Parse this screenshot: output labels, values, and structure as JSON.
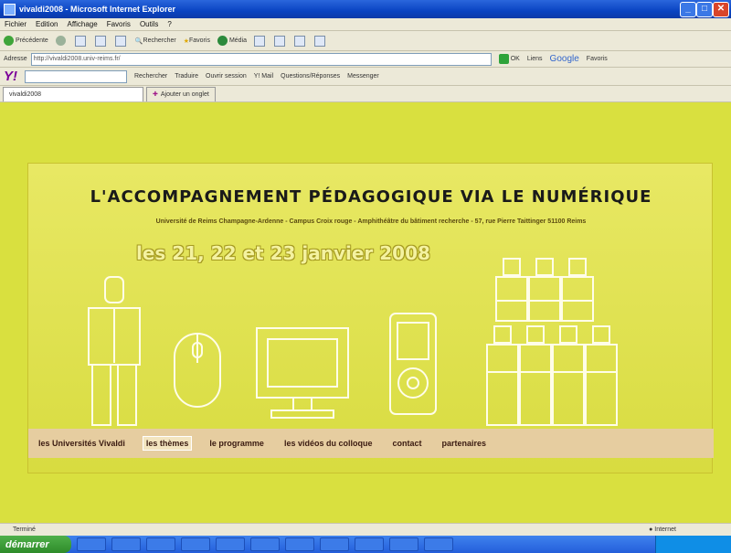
{
  "window": {
    "title": "vivaldi2008 - Microsoft Internet Explorer"
  },
  "menubar": [
    "Fichier",
    "Edition",
    "Affichage",
    "Favoris",
    "Outils",
    "?"
  ],
  "toolbar": {
    "back": "Précédente",
    "search": "Rechercher",
    "favorites": "Favoris",
    "media": "Média"
  },
  "addressbar": {
    "label": "Adresse",
    "url": "http://vivaldi2008.univ-reims.fr/",
    "go": "OK",
    "links": "Liens",
    "google": "Google",
    "favorites": "Favoris"
  },
  "yahoobar": {
    "logo": "Y!",
    "search_btn": "Rechercher",
    "translate": "Traduire",
    "open_session": "Ouvrir session",
    "mail": "Y! Mail",
    "qa": "Questions/Réponses",
    "messenger": "Messenger"
  },
  "tabs": [
    {
      "label": "vivaldi2008"
    },
    {
      "label": "Ajouter un onglet"
    }
  ],
  "banner": {
    "title": "L'ACCOMPAGNEMENT PÉDAGOGIQUE VIA LE NUMÉRIQUE",
    "subtitle": "Université de Reims Champagne-Ardenne - Campus Croix rouge - Amphithéâtre du bâtiment recherche - 57, rue Pierre Taittinger 51100 Reims",
    "dates": "les 21, 22 et 23 janvier 2008"
  },
  "nav": [
    {
      "label": "les Universités Vivaldi",
      "active": false
    },
    {
      "label": "les thèmes",
      "active": true
    },
    {
      "label": "le programme",
      "active": false
    },
    {
      "label": "les vidéos du colloque",
      "active": false
    },
    {
      "label": "contact",
      "active": false
    },
    {
      "label": "partenaires",
      "active": false
    }
  ],
  "statusbar": {
    "left": "Terminé",
    "zone": "Internet"
  },
  "taskbar": {
    "start": "démarrer"
  },
  "colors": {
    "page_bg": "#d9e03f",
    "nav_bg": "#e6cda0",
    "title_text": "#1a1a1a",
    "outline": "#ffffff"
  }
}
